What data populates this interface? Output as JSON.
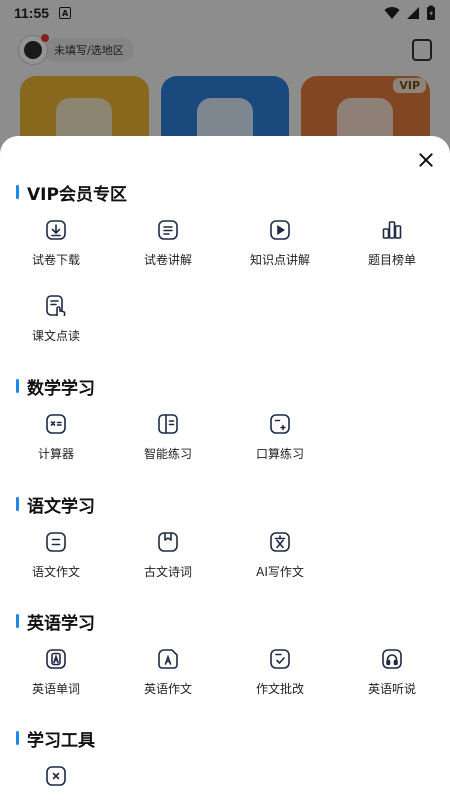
{
  "status_bar": {
    "time": "11:55",
    "a_icon": "A"
  },
  "header": {
    "region": "未填写/选地区"
  },
  "background_cards": [
    {
      "badge": ""
    },
    {
      "badge": ""
    },
    {
      "badge": "VIP"
    }
  ],
  "sheet": {
    "sections": [
      {
        "title": "VIP会员专区",
        "items": [
          {
            "label": "试卷下载",
            "icon": "download-doc-icon"
          },
          {
            "label": "试卷讲解",
            "icon": "doc-lines-icon"
          },
          {
            "label": "知识点讲解",
            "icon": "play-icon"
          },
          {
            "label": "题目榜单",
            "icon": "bar-chart-icon"
          },
          {
            "label": "课文点读",
            "icon": "tap-read-icon"
          }
        ]
      },
      {
        "title": "数学学习",
        "items": [
          {
            "label": "计算器",
            "icon": "calculator-icon"
          },
          {
            "label": "智能练习",
            "icon": "book-icon"
          },
          {
            "label": "口算练习",
            "icon": "mental-math-icon"
          }
        ]
      },
      {
        "title": "语文学习",
        "items": [
          {
            "label": "语文作文",
            "icon": "essay-icon"
          },
          {
            "label": "古文诗词",
            "icon": "bookmark-icon"
          },
          {
            "label": "AI写作文",
            "icon": "wen-char-icon"
          }
        ]
      },
      {
        "title": "英语学习",
        "items": [
          {
            "label": "英语单词",
            "icon": "letter-a-icon"
          },
          {
            "label": "英语作文",
            "icon": "letter-a-doc-icon"
          },
          {
            "label": "作文批改",
            "icon": "correction-icon"
          },
          {
            "label": "英语听说",
            "icon": "headphones-icon"
          }
        ]
      },
      {
        "title": "学习工具",
        "items": [
          {
            "label": "",
            "icon": "x-tool-icon"
          }
        ]
      }
    ]
  },
  "colors": {
    "accent": "#1e88e5",
    "icon_stroke": "#1f2a44"
  }
}
